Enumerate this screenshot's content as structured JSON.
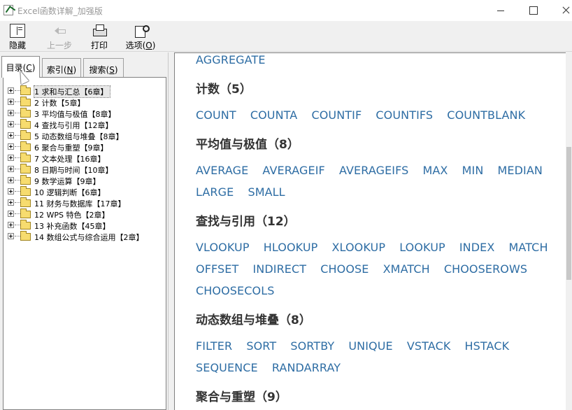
{
  "window": {
    "title": "Excel函数详解_加强版"
  },
  "toolbar": {
    "hide": "隐藏",
    "back": "上一步",
    "print": "打印",
    "options_prefix": "选项(",
    "options_key": "O",
    "options_suffix": ")"
  },
  "tabs": [
    {
      "prefix": "目录(",
      "key": "C",
      "suffix": ")"
    },
    {
      "prefix": "索引(",
      "key": "N",
      "suffix": ")"
    },
    {
      "prefix": "搜索(",
      "key": "S",
      "suffix": ")"
    }
  ],
  "tree": [
    "1 求和与汇总【6章】",
    "2 计数【5章】",
    "3 平均值与极值【8章】",
    "4 查找与引用【12章】",
    "5 动态数组与堆叠【8章】",
    "6 聚合与重塑【9章】",
    "7 文本处理【16章】",
    "8 日期与时间【10章】",
    "9 数学运算【9章】",
    "10 逻辑判断【6章】",
    "11 财务与数据库【17章】",
    "12 WPS 特色【2章】",
    "13 补充函数【45章】",
    "14 数组公式与综合运用【2章】"
  ],
  "content": {
    "top_line": "AGGREGATE",
    "sections": [
      {
        "title": "计数（5）",
        "rows": [
          [
            "COUNT",
            "COUNTA",
            "COUNTIF",
            "COUNTIFS",
            "COUNTBLANK"
          ]
        ]
      },
      {
        "title": "平均值与极值（8）",
        "rows": [
          [
            "AVERAGE",
            "AVERAGEIF",
            "AVERAGEIFS",
            "MAX",
            "MIN",
            "MEDIAN"
          ],
          [
            "LARGE",
            "SMALL"
          ]
        ]
      },
      {
        "title": "查找与引用（12）",
        "rows": [
          [
            "VLOOKUP",
            "HLOOKUP",
            "XLOOKUP",
            "LOOKUP",
            "INDEX",
            "MATCH"
          ],
          [
            "OFFSET",
            "INDIRECT",
            "CHOOSE",
            "XMATCH",
            "CHOOSEROWS"
          ],
          [
            "CHOOSECOLS"
          ]
        ]
      },
      {
        "title": "动态数组与堆叠（8）",
        "rows": [
          [
            "FILTER",
            "SORT",
            "SORTBY",
            "UNIQUE",
            "VSTACK",
            "HSTACK"
          ],
          [
            "SEQUENCE",
            "RANDARRAY"
          ]
        ]
      },
      {
        "title": "聚合与重塑（9）",
        "rows": []
      }
    ]
  },
  "colors": {
    "link": "#2e6da4",
    "heading": "#333333"
  }
}
